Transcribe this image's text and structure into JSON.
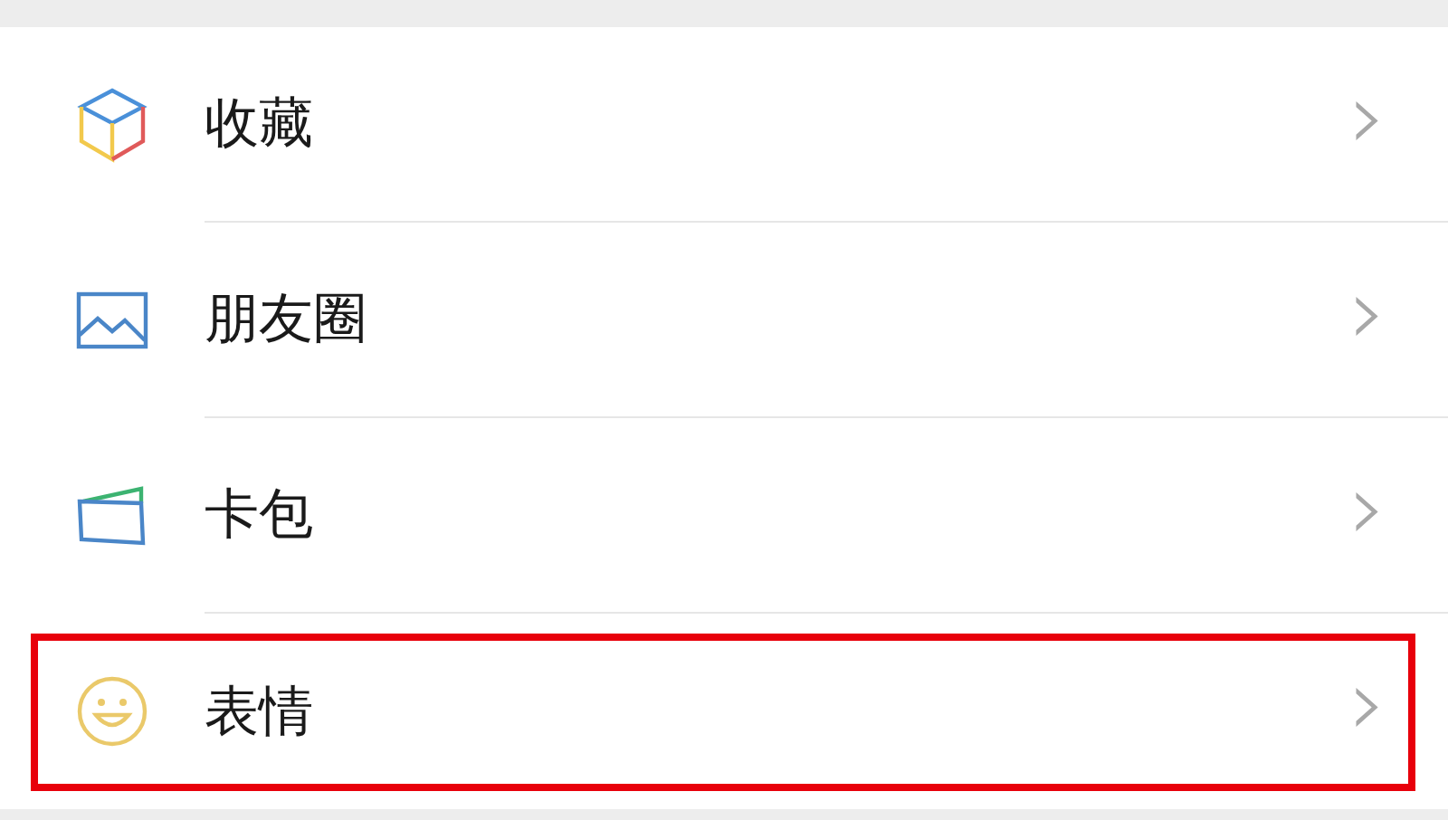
{
  "menu_items": [
    {
      "kind": "favorites",
      "label": "收藏",
      "chevron": "›",
      "highlighted": false
    },
    {
      "kind": "moments",
      "label": "朋友圈",
      "chevron": "›",
      "highlighted": false
    },
    {
      "kind": "cards",
      "label": "卡包",
      "chevron": "›",
      "highlighted": false
    },
    {
      "kind": "stickers",
      "label": "表情",
      "chevron": "›",
      "highlighted": true
    }
  ]
}
